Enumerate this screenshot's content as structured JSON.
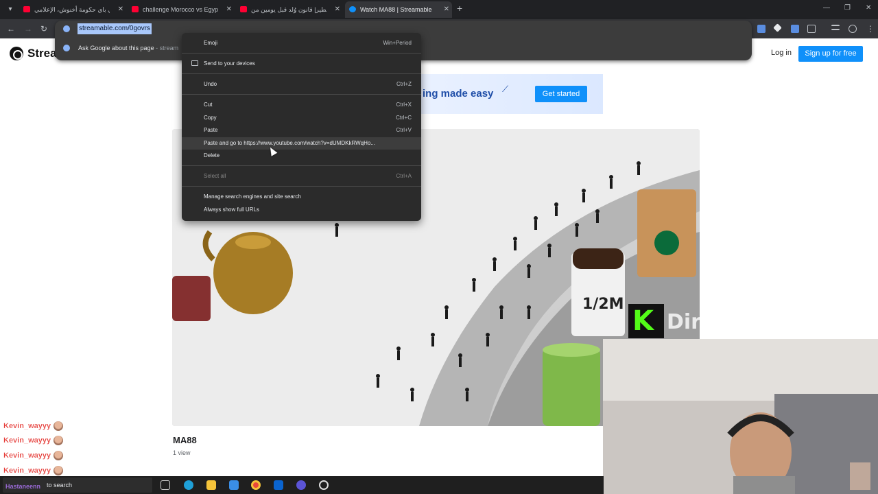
{
  "browser": {
    "tabs": [
      {
        "title": "باي باي حكومة أخنوش، الإعلامي"
      },
      {
        "title": "challenge Morocco vs Egypt"
      },
      {
        "title": "خطير| قانون وُلد قبل يومين من"
      },
      {
        "title": "Watch MA88 | Streamable",
        "active": true
      }
    ],
    "url": "streamable.com/0govrs",
    "suggestion": "Ask Google about this page",
    "suggestion_sub": " - stream"
  },
  "context_menu": {
    "items": [
      {
        "label": "Emoji",
        "shortcut": "Win+Period"
      },
      {
        "label": "Send to your devices",
        "shortcut": ""
      },
      {
        "label": "Undo",
        "shortcut": "Ctrl+Z"
      },
      {
        "label": "Cut",
        "shortcut": "Ctrl+X"
      },
      {
        "label": "Copy",
        "shortcut": "Ctrl+C"
      },
      {
        "label": "Paste",
        "shortcut": "Ctrl+V"
      },
      {
        "label": "Paste and go to https://www.youtube.com/watch?v=dUMDKkRWqHo...",
        "shortcut": ""
      },
      {
        "label": "Delete",
        "shortcut": ""
      },
      {
        "label": "Select all",
        "shortcut": "Ctrl+A"
      },
      {
        "label": "Manage search engines and site search",
        "shortcut": ""
      },
      {
        "label": "Always show full URLs",
        "shortcut": ""
      }
    ]
  },
  "page": {
    "logo": "Strea",
    "login": "Log in",
    "signup": "Sign up for free",
    "banner_text": "ing made easy",
    "banner_button": "Get started",
    "video_title": "MA88",
    "views": "1 view",
    "cup_label": "1/2M"
  },
  "chat": {
    "messages": [
      {
        "user": "Kevin_wayyy"
      },
      {
        "user": "Kevin_wayyy"
      },
      {
        "user": "Kevin_wayyy"
      },
      {
        "user": "Kevin_wayyy"
      }
    ]
  },
  "taskbar": {
    "search": "to search",
    "watermark": "Hastaneenn"
  },
  "stream": {
    "platform_letter": "K",
    "channel": "DirtyHowaAness"
  },
  "colors": {
    "accent": "#0f90fa",
    "kick_green": "#53fc18",
    "chat_user": "#e53935"
  }
}
